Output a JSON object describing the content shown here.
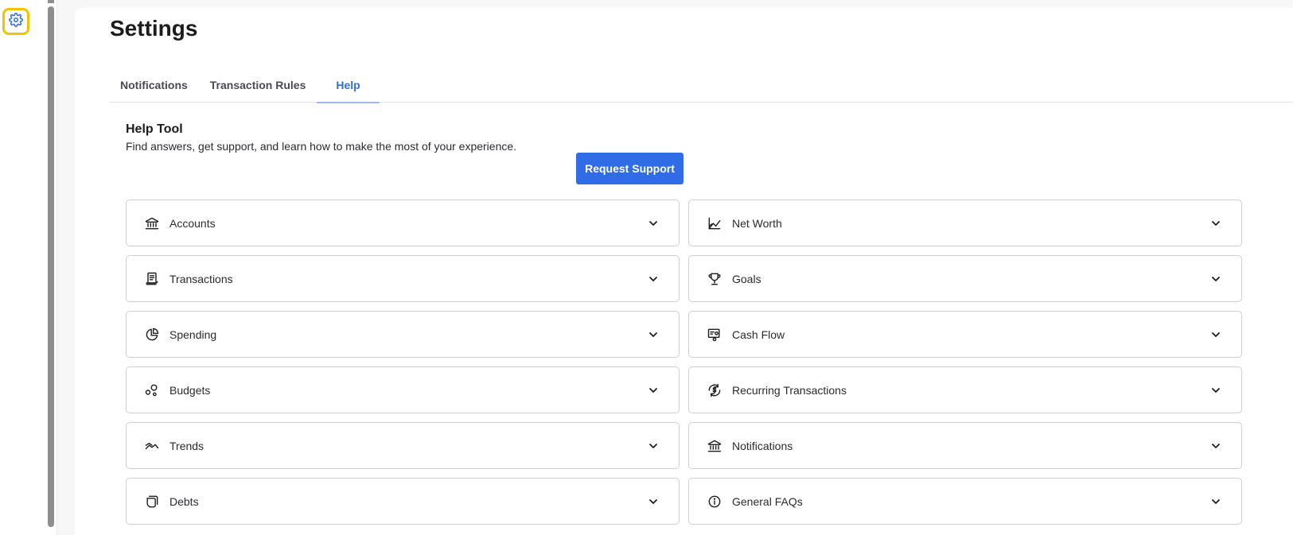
{
  "rail": {
    "icon": "gear-icon",
    "highlight_color": "#f3c300",
    "icon_color": "#2f6ce5"
  },
  "page": {
    "title": "Settings"
  },
  "tabs": [
    {
      "label": "Notifications",
      "active": false
    },
    {
      "label": "Transaction Rules",
      "active": false
    },
    {
      "label": "Help",
      "active": true
    }
  ],
  "help": {
    "heading": "Help Tool",
    "description": "Find answers, get support, and learn how to make the most of your experience.",
    "support_button": "Request Support"
  },
  "colors": {
    "accent": "#2f6ce5",
    "card_border": "#cfcfd4"
  },
  "sections": [
    {
      "label": "Accounts",
      "icon": "bank-icon"
    },
    {
      "label": "Net Worth",
      "icon": "chart-up-icon"
    },
    {
      "label": "Transactions",
      "icon": "receipt-icon"
    },
    {
      "label": "Goals",
      "icon": "trophy-icon"
    },
    {
      "label": "Spending",
      "icon": "pie-chart-icon"
    },
    {
      "label": "Cash Flow",
      "icon": "cash-flow-icon"
    },
    {
      "label": "Budgets",
      "icon": "budget-circles-icon"
    },
    {
      "label": "Recurring Transactions",
      "icon": "recurring-dollar-icon"
    },
    {
      "label": "Trends",
      "icon": "trend-line-icon"
    },
    {
      "label": "Notifications",
      "icon": "bank-icon"
    },
    {
      "label": "Debts",
      "icon": "stacked-cards-icon"
    },
    {
      "label": "General FAQs",
      "icon": "info-icon"
    }
  ]
}
